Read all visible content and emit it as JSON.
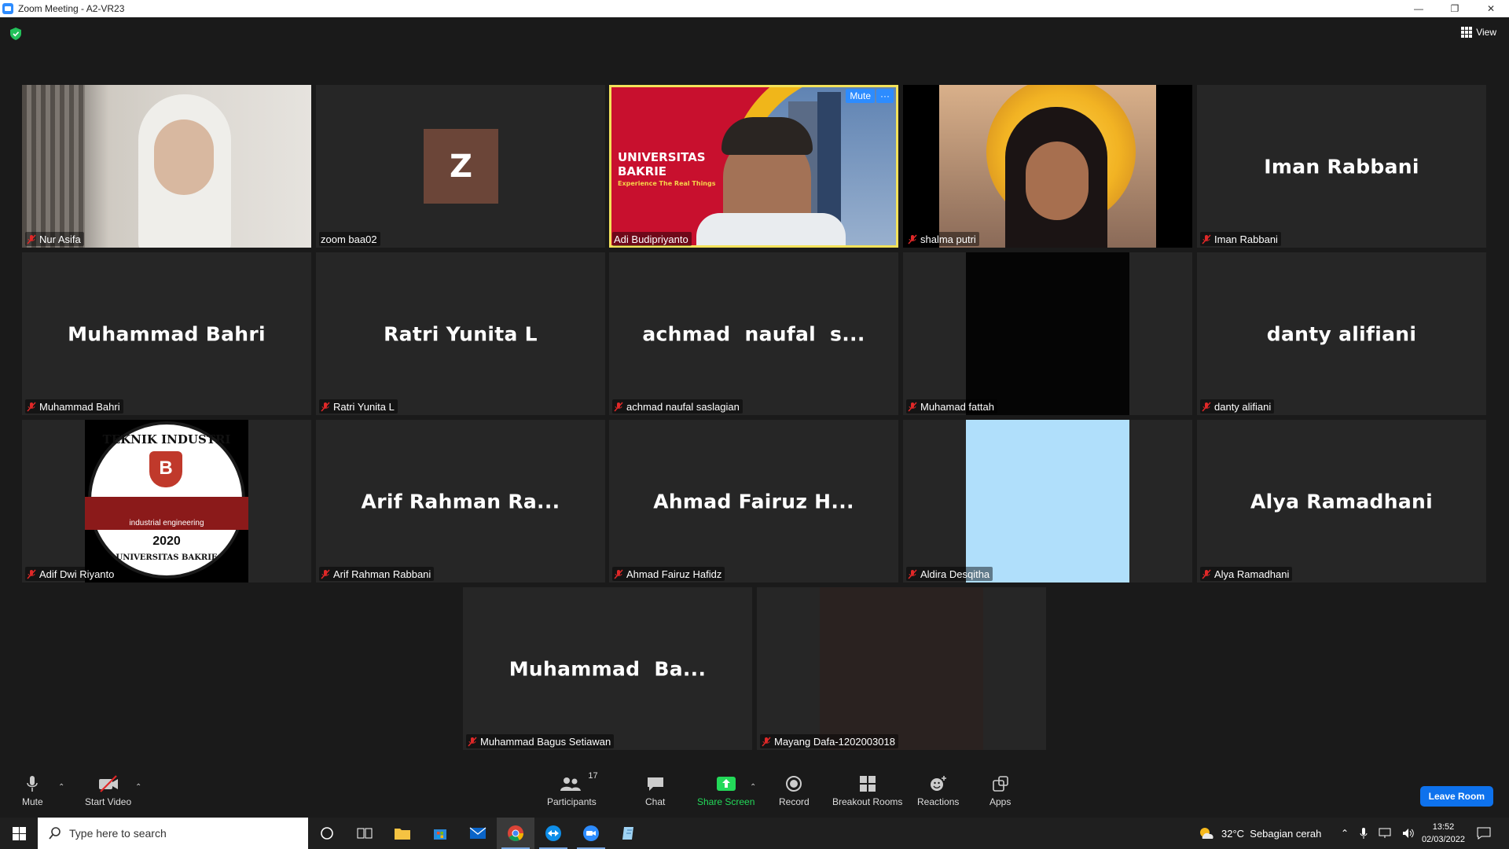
{
  "window": {
    "title": "Zoom Meeting - A2-VR23"
  },
  "meeting": {
    "view_label": "View",
    "tiles": [
      {
        "display": "",
        "label": "Nur Asifa"
      },
      {
        "display": "",
        "label": "zoom baa02",
        "initial": "Z"
      },
      {
        "display": "",
        "label": "Adi Budipriyanto",
        "mute": "Mute",
        "more": "···"
      },
      {
        "display": "",
        "label": "shalma putri"
      },
      {
        "display": "Iman Rabbani",
        "label": "Iman Rabbani"
      },
      {
        "display": "Muhammad Bahri",
        "label": "Muhammad Bahri"
      },
      {
        "display": "Ratri Yunita L",
        "label": "Ratri Yunita L"
      },
      {
        "display": "achmad  naufal  s...",
        "label": "achmad naufal saslagian"
      },
      {
        "display": "",
        "label": "Muhamad fattah"
      },
      {
        "display": "danty alifiani",
        "label": "danty alifiani"
      },
      {
        "display": "",
        "label": "Adif Dwi Riyanto"
      },
      {
        "display": "Arif Rahman Ra...",
        "label": "Arif Rahman Rabbani"
      },
      {
        "display": "Ahmad Fairuz H...",
        "label": "Ahmad Fairuz Hafidz"
      },
      {
        "display": "",
        "label": "Aldira Desqitha"
      },
      {
        "display": "Alya Ramadhani",
        "label": "Alya Ramadhani"
      },
      {
        "display": "Muhammad  Ba...",
        "label": "Muhammad Bagus Setiawan"
      },
      {
        "display": "",
        "label": "Mayang Dafa-1202003018"
      }
    ],
    "banner": {
      "line1": "UNIVERSITAS",
      "line2": "BAKRIE",
      "tagline": "Experience The Real Things"
    },
    "logo": {
      "top": "TEKNIK INDUSTRI",
      "middle": "industrial engineering",
      "year": "2020",
      "bottom": "UNIVERSITAS BAKRIE"
    }
  },
  "toolbar": {
    "mute": "Mute",
    "start_video": "Start Video",
    "participants": "Participants",
    "participants_count": "17",
    "chat": "Chat",
    "share_screen": "Share Screen",
    "record": "Record",
    "breakout_rooms": "Breakout Rooms",
    "reactions": "Reactions",
    "apps": "Apps",
    "leave": "Leave Room"
  },
  "taskbar": {
    "search_placeholder": "Type here to search",
    "weather": "32°C  Sebagian cerah",
    "time": "13:52",
    "date": "02/03/2022"
  },
  "colors": {
    "accent": "#2d8cff",
    "active_speaker": "#f3e25a",
    "share_green": "#23d959",
    "leave_blue": "#0e72ed"
  }
}
